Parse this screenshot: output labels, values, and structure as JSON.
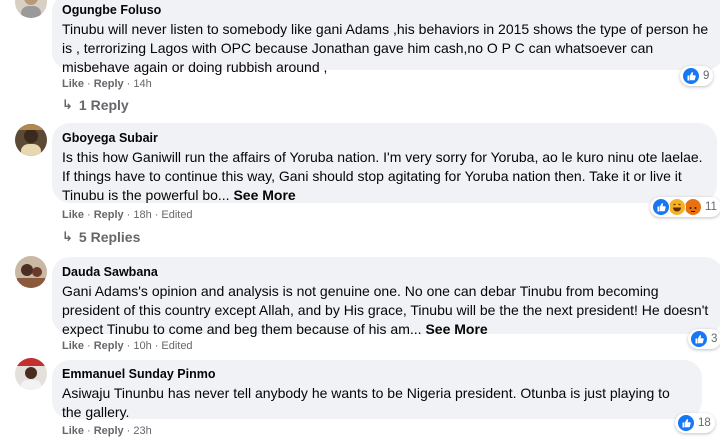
{
  "comments": [
    {
      "name": "Ogungbe Foluso",
      "text": "Tinubu will never listen to somebody like gani Adams ,his behaviors in 2015 shows the type of person he is , terrorizing Lagos with OPC because Jonathan gave him cash,no O P C can whatsoever can misbehave again or doing rubbish around ,",
      "see_more": "",
      "actions": {
        "like": "Like",
        "reply": "Reply",
        "time": "14h",
        "edited": ""
      },
      "reactions": {
        "icons": [
          "like-icon"
        ],
        "count": "9"
      },
      "replies": "1 Reply"
    },
    {
      "name": "Gboyega Subair",
      "text": "Is this how Ganiwill run the affairs of Yoruba nation. I'm very sorry for Yoruba, ao le kuro ninu ote laelae. If things have to continue this way, Gani should stop agitating for Yoruba nation then. Take it or live it Tinubu is the powerful bo...",
      "see_more": "See More",
      "actions": {
        "like": "Like",
        "reply": "Reply",
        "time": "18h",
        "edited": "Edited"
      },
      "reactions": {
        "icons": [
          "like-icon",
          "haha-icon",
          "angry-icon"
        ],
        "count": "11"
      },
      "replies": "5 Replies"
    },
    {
      "name": "Dauda Sawbana",
      "text": "Gani Adams's opinion and analysis is not genuine one. No one can debar Tinubu from becoming president of this country except Allah, and by His grace, Tinubu will be the the next president! He doesn't expect Tinubu to come and beg them because of his am...",
      "see_more": "See More",
      "actions": {
        "like": "Like",
        "reply": "Reply",
        "time": "10h",
        "edited": "Edited"
      },
      "reactions": {
        "icons": [
          "like-icon"
        ],
        "count": "3"
      },
      "replies": ""
    },
    {
      "name": "Emmanuel Sunday Pinmo",
      "text": "Asiwaju Tinunbu has never tell anybody he wants to be Nigeria president. Otunba is just playing to the gallery.",
      "see_more": "",
      "actions": {
        "like": "Like",
        "reply": "Reply",
        "time": "23h",
        "edited": ""
      },
      "reactions": {
        "icons": [
          "like-icon"
        ],
        "count": "18"
      },
      "replies": ""
    }
  ],
  "colors": {
    "like": "#1877f2",
    "haha": "#f7b125",
    "angry": "#e9710f",
    "meta": "#65676b",
    "bubble": "#f0f2f5"
  }
}
